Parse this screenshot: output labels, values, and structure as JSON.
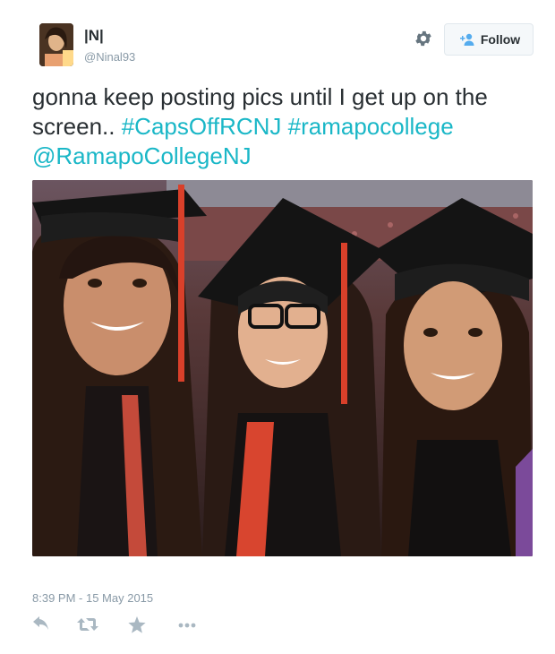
{
  "author": {
    "display_name": "|N|",
    "handle": "@Ninal93"
  },
  "follow_button": {
    "label": "Follow",
    "icon": "add-user-icon"
  },
  "settings_icon": "gear-icon",
  "tweet": {
    "text_prefix": "gonna keep posting pics until I get up on the screen.. ",
    "hashtags": [
      "#CapsOffRCNJ",
      "#ramapocollege"
    ],
    "mention": "@RamapoCollegeNJ",
    "link_color": "#1ab7c7",
    "photo": {
      "alt_content": "Selfie of three graduates in black caps and gowns at a commencement ceremony"
    },
    "timestamp": "8:39 PM - 15 May 2015"
  },
  "actions": [
    {
      "name": "reply",
      "icon": "reply-icon"
    },
    {
      "name": "retweet",
      "icon": "retweet-icon"
    },
    {
      "name": "favorite",
      "icon": "star-icon"
    },
    {
      "name": "more",
      "icon": "more-icon"
    }
  ]
}
